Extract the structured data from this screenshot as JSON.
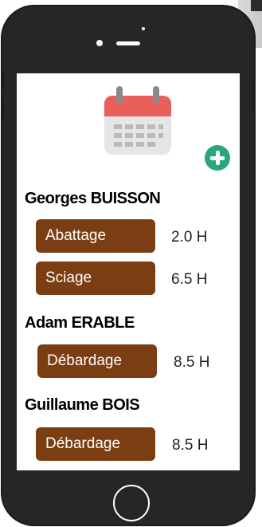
{
  "colors": {
    "phone_body": "#262626",
    "task_pill": "#7a3e12",
    "add_button": "#2aa67a",
    "calendar_header": "#e85f5c"
  },
  "icons": {
    "calendar": "calendar-icon",
    "add": "plus-circle-icon",
    "home": "home-button-icon"
  },
  "people": [
    {
      "name": "Georges BUISSON",
      "tasks": [
        {
          "label": "Abattage",
          "hours": "2.0 H"
        },
        {
          "label": "Sciage",
          "hours": "6.5 H"
        }
      ]
    },
    {
      "name": "Adam ERABLE",
      "tasks": [
        {
          "label": "Débardage",
          "hours": "8.5 H"
        }
      ]
    },
    {
      "name": "Guillaume BOIS",
      "tasks": [
        {
          "label": "Débardage",
          "hours": "8.5 H"
        }
      ]
    }
  ]
}
